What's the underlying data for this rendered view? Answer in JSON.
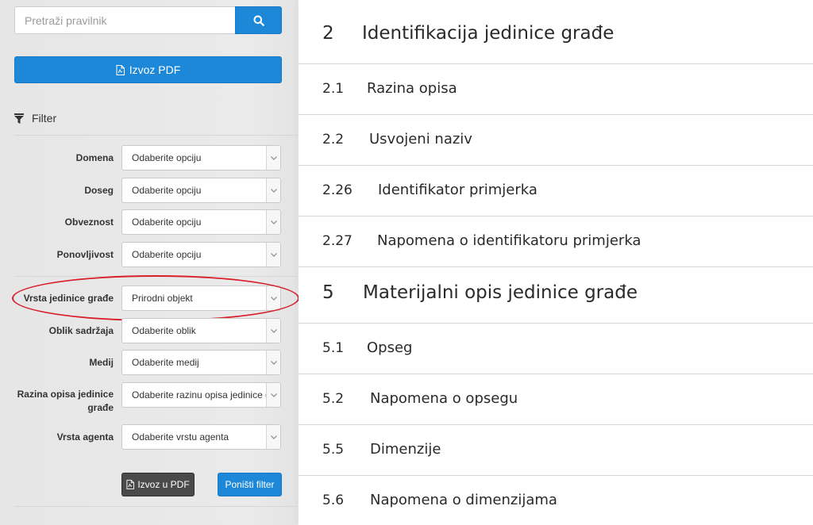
{
  "search": {
    "placeholder": "Pretraži pravilnik"
  },
  "export_pdf_main": "Izvoz PDF",
  "filter": {
    "heading": "Filter",
    "fields": [
      {
        "label": "Domena",
        "value": "Odaberite opciju"
      },
      {
        "label": "Doseg",
        "value": "Odaberite opciju"
      },
      {
        "label": "Obveznost",
        "value": "Odaberite opciju"
      },
      {
        "label": "Ponovljivost",
        "value": "Odaberite opciju"
      },
      {
        "label": "Vrsta jedinice građe",
        "value": "Prirodni objekt"
      },
      {
        "label": "Oblik sadržaja",
        "value": "Odaberite oblik"
      },
      {
        "label": "Medij",
        "value": "Odaberite medij"
      },
      {
        "label": "Razina opisa jedinice građe",
        "value": "Odaberite razinu opisa jedinice građe"
      },
      {
        "label": "Vrsta agenta",
        "value": "Odaberite vrstu agenta"
      }
    ],
    "export_button": "Izvoz u PDF",
    "reset_button": "Poništi filter"
  },
  "entries": [
    {
      "num": "2",
      "title": "Identifikacija jedinice građe"
    },
    {
      "num": "2.1",
      "title": "Razina opisa"
    },
    {
      "num": "2.2",
      "title": "Usvojeni naziv"
    },
    {
      "num": "2.26",
      "title": "Identifikator primjerka"
    },
    {
      "num": "2.27",
      "title": "Napomena o identifikatoru primjerka"
    },
    {
      "num": "5",
      "title": "Materijalni opis jedinice građe"
    },
    {
      "num": "5.1",
      "title": "Opseg"
    },
    {
      "num": "5.2",
      "title": "Napomena o opsegu"
    },
    {
      "num": "5.5",
      "title": "Dimenzije"
    },
    {
      "num": "5.6",
      "title": "Napomena o dimenzijama"
    }
  ],
  "colors": {
    "accent": "#1e88d8",
    "highlight": "#d81f2a",
    "dark_button": "#4a4a4a"
  }
}
